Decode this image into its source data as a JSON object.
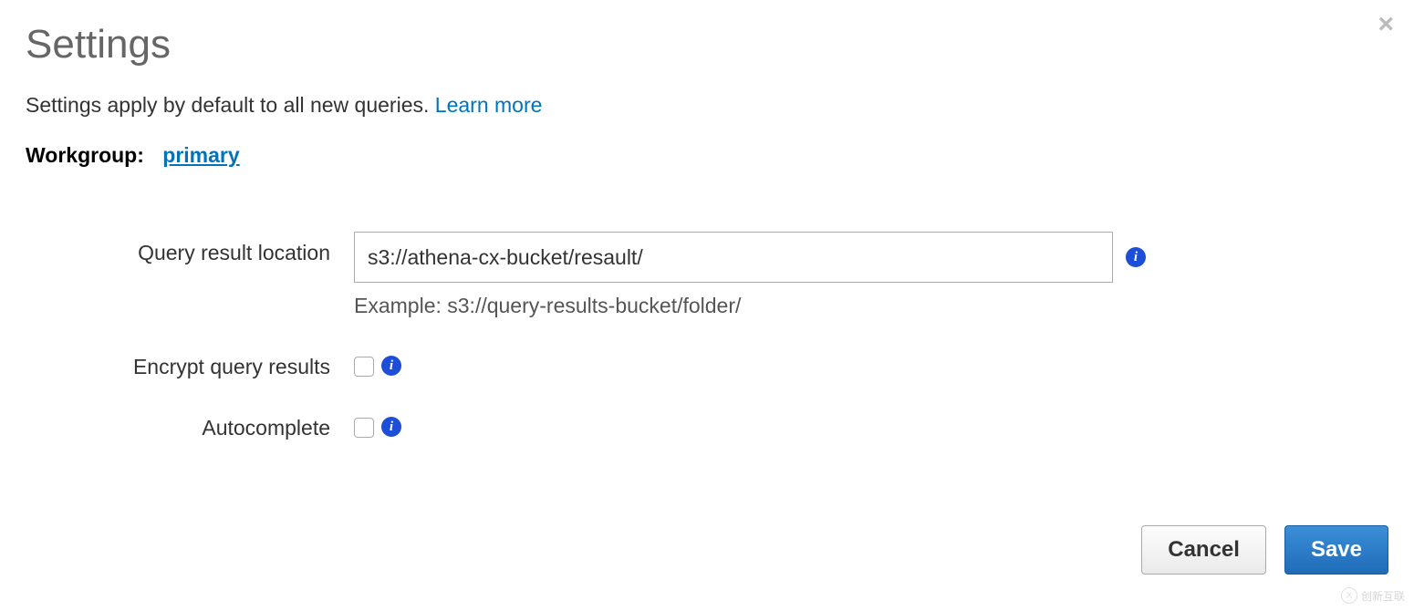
{
  "title": "Settings",
  "intro": {
    "text": "Settings apply by default to all new queries. ",
    "learn_more": "Learn more"
  },
  "workgroup": {
    "label": "Workgroup:",
    "value": "primary"
  },
  "fields": {
    "query_result_location": {
      "label": "Query result location",
      "value": "s3://athena-cx-bucket/resault/",
      "example": "Example: s3://query-results-bucket/folder/"
    },
    "encrypt_query_results": {
      "label": "Encrypt query results",
      "checked": false
    },
    "autocomplete": {
      "label": "Autocomplete",
      "checked": false
    }
  },
  "buttons": {
    "cancel": "Cancel",
    "save": "Save"
  },
  "watermark": "创新互联"
}
